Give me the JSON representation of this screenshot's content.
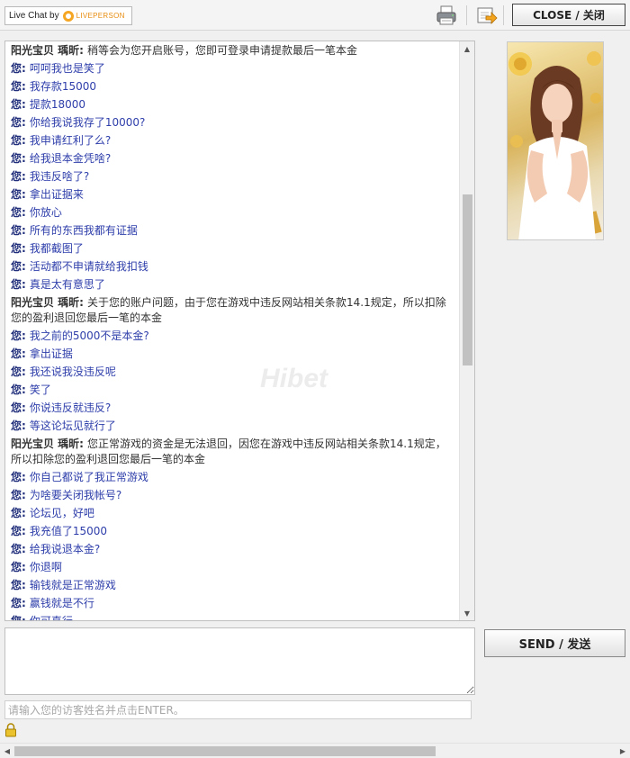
{
  "header": {
    "brand_text": "Live Chat by",
    "brand_name": "LIVEPERSON",
    "close_label": "CLOSE / 关闭"
  },
  "transcript": {
    "watermark": "Hibet",
    "messages": [
      {
        "who": "阳光宝贝 瑀昕:",
        "text": "稍等会为您开启账号，您即可登录申请提款最后一笔本金",
        "agent": true
      },
      {
        "who": "您:",
        "text": "呵呵我也是笑了"
      },
      {
        "who": "您:",
        "text": "我存款15000"
      },
      {
        "who": "您:",
        "text": "提款18000"
      },
      {
        "who": "您:",
        "text": "你给我说我存了10000?"
      },
      {
        "who": "您:",
        "text": "我申请红利了么?"
      },
      {
        "who": "您:",
        "text": "给我退本金凭啥?"
      },
      {
        "who": "您:",
        "text": "我违反啥了?"
      },
      {
        "who": "您:",
        "text": "拿出证据来"
      },
      {
        "who": "您:",
        "text": "你放心"
      },
      {
        "who": "您:",
        "text": "所有的东西我都有证据"
      },
      {
        "who": "您:",
        "text": "我都截图了"
      },
      {
        "who": "您:",
        "text": "活动都不申请就给我扣钱"
      },
      {
        "who": "您:",
        "text": "真是太有意思了"
      },
      {
        "who": "阳光宝贝 瑀昕:",
        "text": "关于您的账户问题，由于您在游戏中违反网站相关条款14.1规定，所以扣除您的盈利退回您最后一笔的本金",
        "agent": true
      },
      {
        "who": "您:",
        "text": "我之前的5000不是本金?"
      },
      {
        "who": "您:",
        "text": "拿出证据"
      },
      {
        "who": "您:",
        "text": "我还说我没违反呢"
      },
      {
        "who": "您:",
        "text": "笑了"
      },
      {
        "who": "您:",
        "text": "你说违反就违反?"
      },
      {
        "who": "您:",
        "text": "等这论坛见就行了"
      },
      {
        "who": "阳光宝贝 瑀昕:",
        "text": "您正常游戏的资金是无法退回，因您在游戏中违反网站相关条款14.1规定，所以扣除您的盈利退回您最后一笔的本金",
        "agent": true
      },
      {
        "who": "您:",
        "text": "你自己都说了我正常游戏"
      },
      {
        "who": "您:",
        "text": "为啥要关闭我帐号?"
      },
      {
        "who": "您:",
        "text": "论坛见，好吧"
      },
      {
        "who": "您:",
        "text": "我充值了15000"
      },
      {
        "who": "您:",
        "text": "给我说退本金?"
      },
      {
        "who": "您:",
        "text": "你退啊"
      },
      {
        "who": "您:",
        "text": "输钱就是正常游戏"
      },
      {
        "who": "您:",
        "text": "赢钱就是不行"
      },
      {
        "who": "您:",
        "text": "你可真行"
      }
    ]
  },
  "composer": {
    "message_value": "",
    "send_label": "SEND / 发送",
    "name_placeholder": "请输入您的访客姓名并点击ENTER。"
  },
  "icons": [
    "print-icon",
    "save-transcript-icon",
    "lock-icon",
    "scroll-up-icon",
    "scroll-down-icon",
    "scroll-left-icon",
    "scroll-right-icon"
  ]
}
